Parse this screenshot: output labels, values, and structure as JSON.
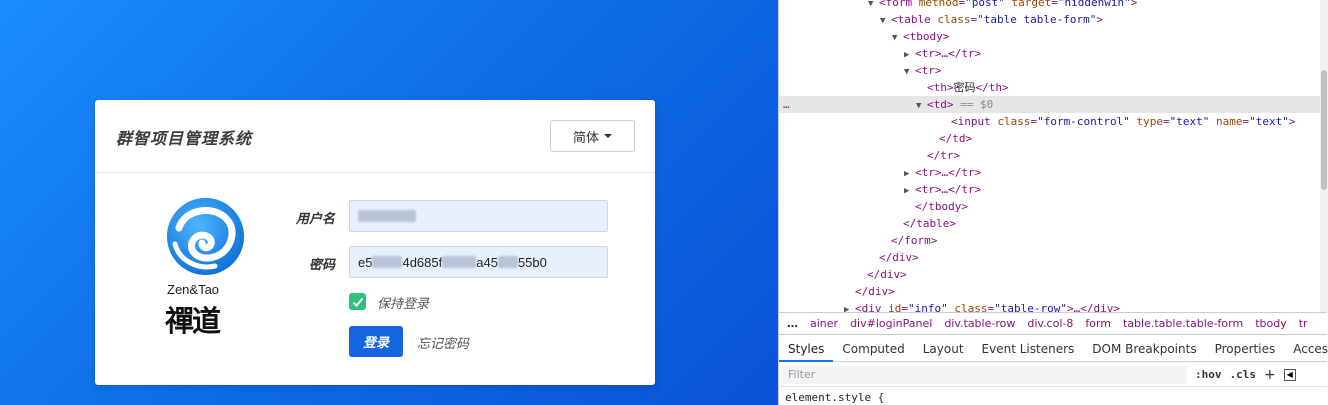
{
  "login": {
    "title": "群智项目管理系统",
    "lang_label": "简体",
    "logo_en": "Zen&Tao",
    "logo_cn": "禪道",
    "username_label": "用户名",
    "password_label": "密码",
    "password_segments": [
      "e5",
      "4d685f",
      "a45",
      "55b0"
    ],
    "remember_label": "保持登录",
    "remember_checked": true,
    "login_button": "登录",
    "forgot_link": "忘记密码",
    "accent_color": "#1565e0",
    "check_color": "#2ec275"
  },
  "devtools": {
    "dom_lines": [
      {
        "indent": 6,
        "tri": "▼",
        "html_tag": "<form",
        "attrs": [
          [
            "method",
            "\"post\""
          ],
          [
            "target",
            "\"hiddenwin\""
          ]
        ],
        "end": ">"
      },
      {
        "indent": 7,
        "tri": "▼",
        "html_tag": "<table",
        "attrs": [
          [
            "class",
            "\"table table-form\""
          ]
        ],
        "end": ">"
      },
      {
        "indent": 8,
        "tri": "▼",
        "html_tag": "<tbody>",
        "attrs": [],
        "end": ""
      },
      {
        "indent": 9,
        "tri": "▶",
        "html_tag": "<tr>…</tr>",
        "attrs": [],
        "end": ""
      },
      {
        "indent": 9,
        "tri": "▼",
        "html_tag": "<tr>",
        "attrs": [],
        "end": ""
      },
      {
        "indent": 10,
        "tri": "",
        "html_tag": "<th>",
        "text": "密码",
        "close": "</th>",
        "attrs": [],
        "end": ""
      },
      {
        "indent": 10,
        "tri": "▼",
        "html_tag": "<td>",
        "attrs": [],
        "end": "",
        "marker": " == $0",
        "selected": true
      },
      {
        "indent": 12,
        "tri": "",
        "html_tag": "<input",
        "attrs": [
          [
            "class",
            "\"form-control\""
          ],
          [
            "type",
            "\"text\""
          ],
          [
            "name",
            "\"text\""
          ]
        ],
        "end": ">"
      },
      {
        "indent": 11,
        "tri": "",
        "html_tag": "</td>",
        "attrs": [],
        "end": ""
      },
      {
        "indent": 10,
        "tri": "",
        "html_tag": "</tr>",
        "attrs": [],
        "end": ""
      },
      {
        "indent": 9,
        "tri": "▶",
        "html_tag": "<tr>…</tr>",
        "attrs": [],
        "end": ""
      },
      {
        "indent": 9,
        "tri": "▶",
        "html_tag": "<tr>…</tr>",
        "attrs": [],
        "end": ""
      },
      {
        "indent": 9,
        "tri": "",
        "html_tag": "</tbody>",
        "attrs": [],
        "end": ""
      },
      {
        "indent": 8,
        "tri": "",
        "html_tag": "</table>",
        "attrs": [],
        "end": ""
      },
      {
        "indent": 7,
        "tri": "",
        "html_tag": "</form>",
        "attrs": [],
        "end": ""
      },
      {
        "indent": 6,
        "tri": "",
        "html_tag": "</div>",
        "attrs": [],
        "end": ""
      },
      {
        "indent": 5,
        "tri": "",
        "html_tag": "</div>",
        "attrs": [],
        "end": ""
      },
      {
        "indent": 4,
        "tri": "",
        "html_tag": "</div>",
        "attrs": [],
        "end": ""
      },
      {
        "indent": 4,
        "tri": "▶",
        "html_tag": "<div",
        "attrs": [
          [
            "id",
            "\"info\""
          ],
          [
            "class",
            "\"table-row\""
          ]
        ],
        "end": ">…</div>"
      }
    ],
    "breadcrumbs": [
      "ainer",
      "div#loginPanel",
      "div.table-row",
      "div.col-8",
      "form",
      "table.table.table-form",
      "tbody",
      "tr"
    ],
    "breadcrumb_more": "…",
    "tabs": [
      "Styles",
      "Computed",
      "Layout",
      "Event Listeners",
      "DOM Breakpoints",
      "Properties",
      "Accessibility"
    ],
    "active_tab": "Styles",
    "filter_placeholder": "Filter",
    "hov_label": ":hov",
    "cls_label": ".cls",
    "plus_label": "+",
    "element_style": "element.style {",
    "ellipsis": "…"
  }
}
